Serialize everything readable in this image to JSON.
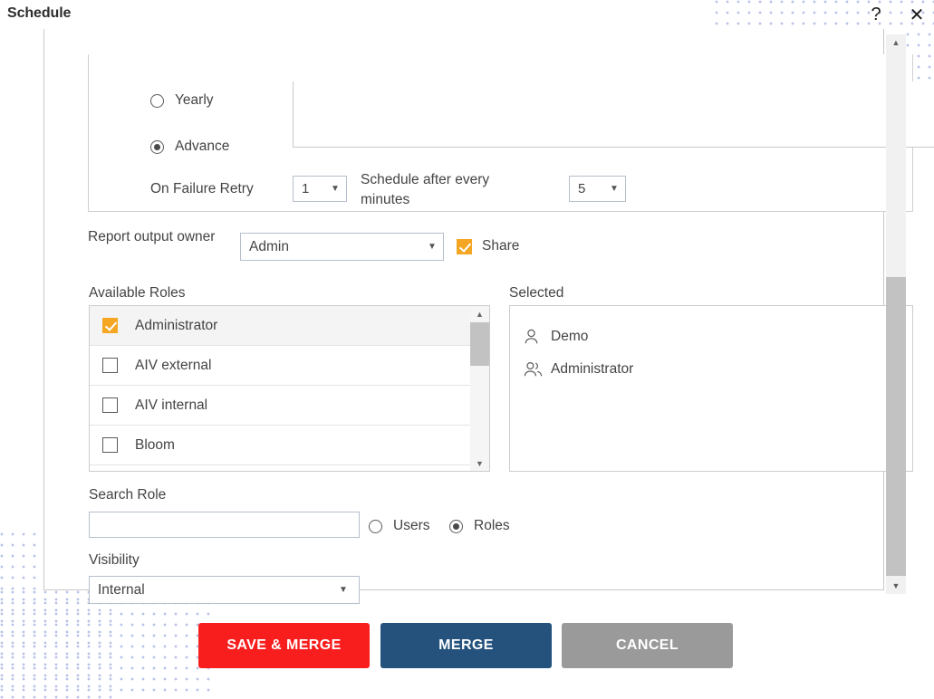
{
  "titlebar": {
    "title": "Schedule",
    "help_icon": "question-mark-icon",
    "close_icon": "close-icon"
  },
  "schedule": {
    "frequency_options": [
      {
        "label": "Yearly",
        "checked": false
      },
      {
        "label": "Advance",
        "checked": true
      }
    ],
    "textarea_value": "",
    "on_failure_retry_label": "On Failure Retry",
    "retry_value": "1",
    "schedule_after_every_label": "Schedule after every minutes",
    "interval_value": "5"
  },
  "report_output": {
    "label": "Report output owner",
    "owner_value": "Admin",
    "share_label": "Share",
    "share_checked": true
  },
  "available_roles": {
    "label": "Available Roles",
    "items": [
      {
        "label": "Administrator",
        "checked": true
      },
      {
        "label": "AIV external",
        "checked": false
      },
      {
        "label": "AIV internal",
        "checked": false
      },
      {
        "label": "Bloom",
        "checked": false
      }
    ]
  },
  "selected": {
    "label": "Selected",
    "items": [
      {
        "name": "Demo",
        "icon": "single-user-icon"
      },
      {
        "name": "Administrator",
        "icon": "group-users-icon"
      }
    ]
  },
  "search_role": {
    "label": "Search Role",
    "value": "",
    "placeholder": "",
    "scope_options": [
      {
        "label": "Users",
        "checked": false
      },
      {
        "label": "Roles",
        "checked": true
      }
    ]
  },
  "visibility": {
    "label": "Visibility",
    "value": "Internal"
  },
  "footer": {
    "save_merge_label": "SAVE & MERGE",
    "merge_label": "MERGE",
    "cancel_label": "CANCEL"
  },
  "colors": {
    "save_merge": "#f91e1e",
    "merge": "#24527d",
    "cancel": "#9a9a9a",
    "accent_checkbox": "#f5a623",
    "dot_pattern": "#b9c2e8"
  }
}
